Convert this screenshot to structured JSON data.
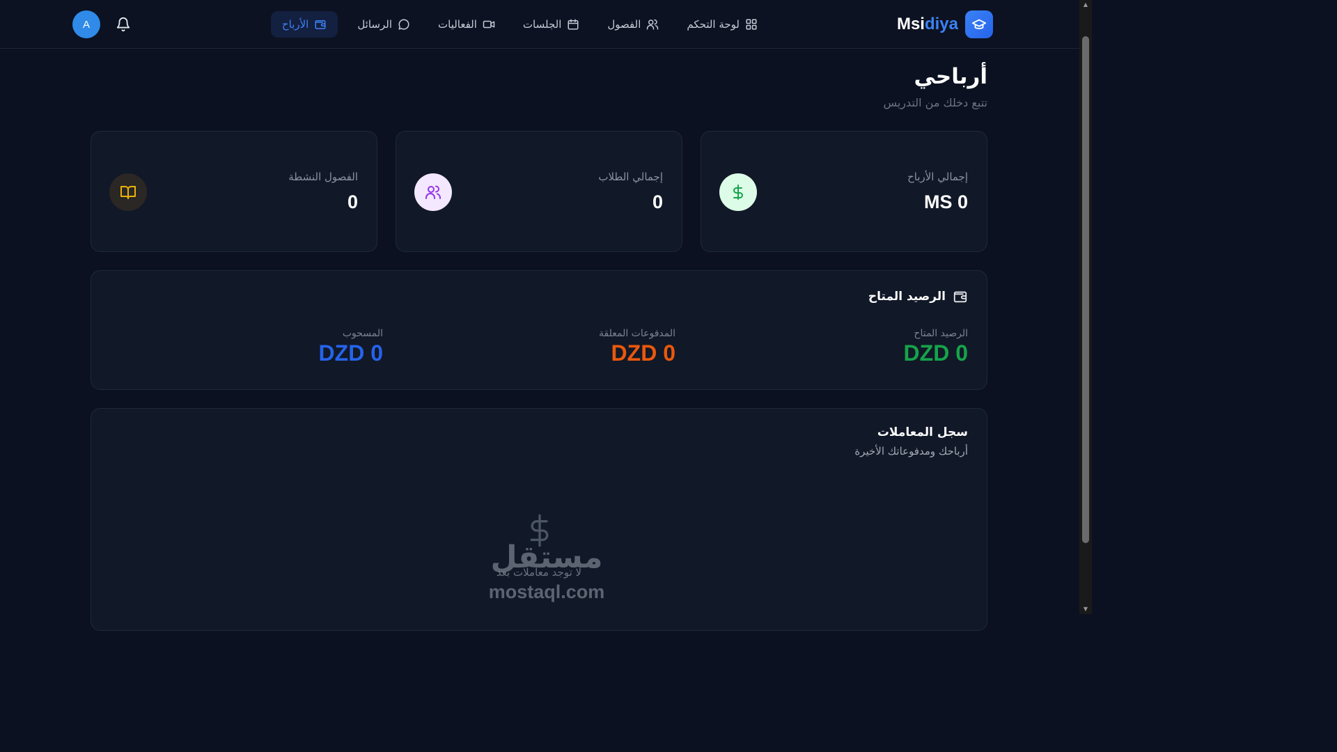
{
  "brand": {
    "name_part1": "Msi",
    "name_part2": "diya",
    "icon": "graduation-cap-icon",
    "accent": "#3b82f6"
  },
  "nav": {
    "items": [
      {
        "label": "لوحة التحكم",
        "icon": "dashboard-grid-icon",
        "active": false
      },
      {
        "label": "الفصول",
        "icon": "users-icon",
        "active": false
      },
      {
        "label": "الجلسات",
        "icon": "calendar-icon",
        "active": false
      },
      {
        "label": "الفعاليات",
        "icon": "video-icon",
        "active": false
      },
      {
        "label": "الرسائل",
        "icon": "message-icon",
        "active": false
      },
      {
        "label": "الأرباح",
        "icon": "wallet-icon",
        "active": true
      }
    ]
  },
  "user": {
    "avatar_initial": "A",
    "avatar_color": "#2f8ae8"
  },
  "page": {
    "title": "أرباحي",
    "subtitle": "تتبع دخلك من التدريس"
  },
  "stats": [
    {
      "label": "إجمالي الأرباح",
      "value": "MS 0",
      "icon": "dollar-icon",
      "icon_bg": "#dcfce7",
      "icon_color": "#16a34a"
    },
    {
      "label": "إجمالي الطلاب",
      "value": "0",
      "icon": "users-icon",
      "icon_bg": "#f3e8ff",
      "icon_color": "#9333ea"
    },
    {
      "label": "الفصول النشطة",
      "value": "0",
      "icon": "book-icon",
      "icon_bg": "#2a2725",
      "icon_color": "#eab308"
    }
  ],
  "balance": {
    "title": "الرصيد المتاح",
    "columns": [
      {
        "label": "الرصيد المتاح",
        "value": "DZD 0",
        "color": "#16a34a"
      },
      {
        "label": "المدفوعات المعلقة",
        "value": "DZD 0",
        "color": "#ea580c"
      },
      {
        "label": "المسحوب",
        "value": "DZD 0",
        "color": "#2563eb"
      }
    ]
  },
  "transactions": {
    "title": "سجل المعاملات",
    "subtitle": "أرباحك ومدفوعاتك الأخيرة",
    "empty_text": "لا توجد معاملات بعد"
  },
  "watermark": {
    "logo_text": "مستقل",
    "domain": "mostaql.com"
  }
}
